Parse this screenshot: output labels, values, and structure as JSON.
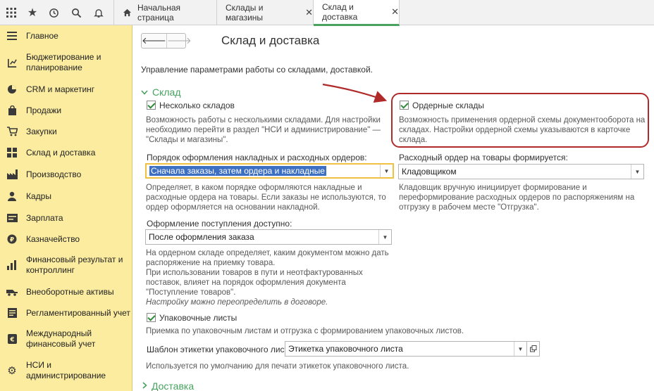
{
  "colors": {
    "accent": "#47a35f",
    "sidebar_bg": "#fbeca0",
    "callout": "#b02a2a",
    "selection": "#3d6fc2"
  },
  "topbar": {
    "icons": [
      "apps-grid-icon",
      "star-icon",
      "history-icon",
      "search-icon",
      "bell-icon"
    ],
    "tabs": [
      {
        "label": "Начальная страница",
        "icon": "home-icon"
      },
      {
        "label": "Склады и магазины",
        "close": "✕"
      },
      {
        "label": "Склад и доставка",
        "close": "✕"
      }
    ]
  },
  "sidebar": {
    "items": [
      {
        "label": "Главное",
        "icon": "menu-lines-icon"
      },
      {
        "label": "Бюджетирование и планирование",
        "icon": "budget-icon"
      },
      {
        "label": "CRM и маркетинг",
        "icon": "pie-chart-icon"
      },
      {
        "label": "Продажи",
        "icon": "shopping-bag-icon"
      },
      {
        "label": "Закупки",
        "icon": "cart-icon"
      },
      {
        "label": "Склад и доставка",
        "icon": "warehouse-grid-icon"
      },
      {
        "label": "Производство",
        "icon": "factory-icon"
      },
      {
        "label": "Кадры",
        "icon": "person-icon"
      },
      {
        "label": "Зарплата",
        "icon": "payroll-icon"
      },
      {
        "label": "Казначейство",
        "icon": "coin-icon"
      },
      {
        "label": "Финансовый результат и контроллинг",
        "icon": "bar-chart-icon"
      },
      {
        "label": "Внеоборотные активы",
        "icon": "vehicle-icon"
      },
      {
        "label": "Регламентированный учет",
        "icon": "document-icon"
      },
      {
        "label": "Международный финансовый учет",
        "icon": "euro-icon"
      },
      {
        "label": "НСИ и администрирование",
        "icon": "gear-icon"
      }
    ]
  },
  "main": {
    "title": "Склад и доставка",
    "description": "Управление параметрами работы со складами, доставкой.",
    "section_sklad": "Склад",
    "section_delivery": "Доставка",
    "multiple_warehouses": {
      "label": "Несколько складов",
      "checked": true,
      "hint": [
        "Возможность работы с несколькими складами. Для настройки",
        "необходимо перейти в раздел \"НСИ и администрирование\" —",
        "\"Склады и магазины\"."
      ]
    },
    "order_warehouses": {
      "label": "Ордерные склады",
      "checked": true,
      "hint": [
        "Возможность применения ордерной схемы документооборота на",
        "складах. Настройки ордерной схемы указываются в карточке",
        "склада."
      ]
    },
    "doc_order": {
      "label": "Порядок оформления накладных и расходных ордеров:",
      "value": "Сначала заказы, затем ордера и накладные",
      "hint": [
        "Определяет, в каком порядке оформляются накладные и",
        "расходные ордера на товары. Если заказы не используются, то",
        "ордер оформляется на основании накладной."
      ]
    },
    "expense_order": {
      "label": "Расходный ордер на товары формируется:",
      "value": "Кладовщиком",
      "hint": [
        "Кладовщик вручную инициирует формирование и",
        "переформирование расходных ордеров по распоряжениям на",
        "отгрузку в рабочем месте \"Отгрузка\"."
      ]
    },
    "receipt": {
      "label": "Оформление поступления доступно:",
      "value": "После оформления заказа",
      "hint": [
        "На ордерном складе определяет, каким документом можно дать",
        "распоряжение на приемку товара.",
        "При использовании товаров в пути и неотфактурованных",
        "поставок, влияет на порядок оформления документа",
        "\"Поступление товаров\"."
      ],
      "note": "Настройку можно переопределить в договоре."
    },
    "packing_lists": {
      "label": "Упаковочные листы",
      "checked": true,
      "hint": "Приемка по упаковочным листам и отгрузка с формированием упаковочных листов."
    },
    "label_template": {
      "label": "Шаблон этикетки упаковочного листа:",
      "value": "Этикетка упаковочного листа",
      "hint": "Используется по умолчанию для печати этикеток упаковочного листа."
    }
  }
}
